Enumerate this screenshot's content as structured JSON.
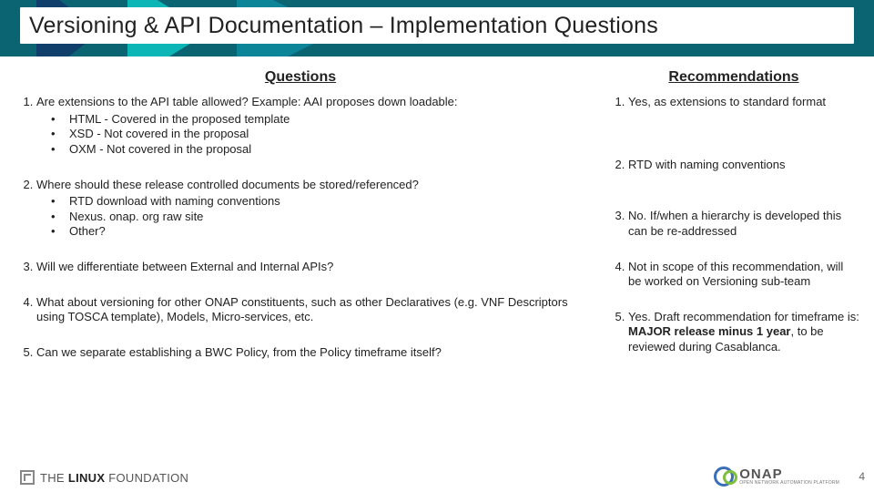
{
  "slide": {
    "title": "Versioning & API Documentation – Implementation Questions",
    "page_number": "4"
  },
  "left": {
    "heading": "Questions",
    "items": [
      {
        "text": "Are extensions to the API table allowed? Example: AAI proposes down loadable:",
        "sub": [
          "HTML - Covered in the proposed template",
          "XSD - Not covered in the proposal",
          "OXM - Not covered in the proposal"
        ]
      },
      {
        "text": "Where should these release controlled documents be stored/referenced?",
        "sub": [
          "RTD download with naming conventions",
          "Nexus. onap. org raw site",
          "Other?"
        ]
      },
      {
        "text": "Will we differentiate between External and Internal APIs?"
      },
      {
        "text": "What about versioning for other ONAP constituents, such as other Declaratives (e.g. VNF Descriptors using TOSCA template), Models, Micro-services, etc."
      },
      {
        "text": "Can we separate establishing a BWC Policy, from the Policy timeframe itself?"
      }
    ]
  },
  "right": {
    "heading": "Recommendations",
    "items": [
      {
        "text": "Yes, as extensions to standard format"
      },
      {
        "text": "RTD with naming conventions"
      },
      {
        "text": "No. If/when a hierarchy is developed this can be re-addressed"
      },
      {
        "text": "Not in scope of this recommendation, will be worked on Versioning sub-team"
      },
      {
        "prefix": "Yes.  Draft recommendation for timeframe is: ",
        "bold": "MAJOR release minus 1 year",
        "suffix": ", to be reviewed during Casablanca."
      }
    ]
  },
  "footer": {
    "linux_foundation_1": "THE",
    "linux_foundation_2": "LINUX",
    "linux_foundation_3": "FOUNDATION",
    "onap_name": "ONAP",
    "onap_tag": "OPEN NETWORK AUTOMATION PLATFORM"
  }
}
